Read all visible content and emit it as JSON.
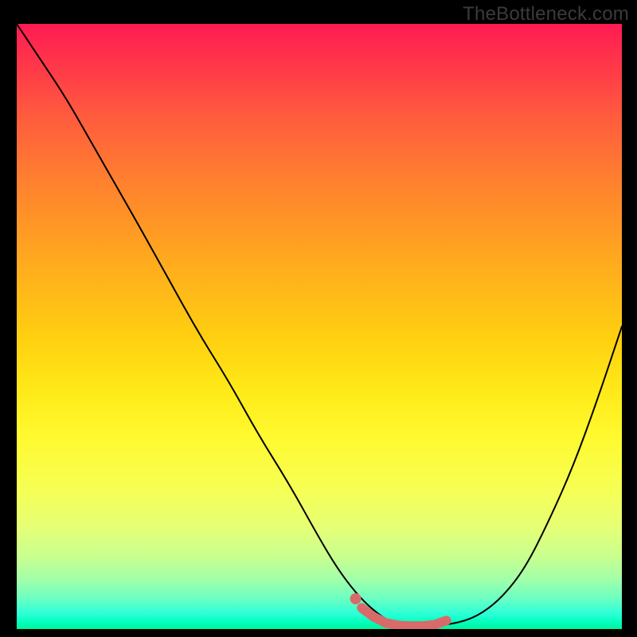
{
  "watermark": "TheBottleneck.com",
  "chart_data": {
    "type": "line",
    "title": "",
    "xlabel": "",
    "ylabel": "",
    "xlim": [
      0,
      100
    ],
    "ylim": [
      0,
      100
    ],
    "grid": false,
    "legend": false,
    "background_gradient": {
      "direction": "vertical",
      "stops": [
        {
          "pos": 0.0,
          "color": "#ff1b53"
        },
        {
          "pos": 0.15,
          "color": "#ff5a3e"
        },
        {
          "pos": 0.38,
          "color": "#ffa61f"
        },
        {
          "pos": 0.6,
          "color": "#ffe817"
        },
        {
          "pos": 0.77,
          "color": "#f6ff55"
        },
        {
          "pos": 0.92,
          "color": "#9fffaa"
        },
        {
          "pos": 1.0,
          "color": "#00f59a"
        }
      ]
    },
    "series": [
      {
        "name": "black-curve",
        "color": "#000000",
        "stroke_width": 2,
        "x": [
          0,
          4,
          8,
          12,
          16,
          20,
          25,
          30,
          35,
          40,
          45,
          50,
          53,
          56,
          59,
          62,
          65,
          68,
          72,
          76,
          80,
          84,
          88,
          92,
          96,
          100
        ],
        "y": [
          100,
          94,
          88,
          81,
          74,
          67,
          58,
          49,
          41,
          32,
          24,
          15,
          10,
          6,
          3,
          1,
          0.5,
          0.5,
          0.8,
          2,
          5,
          10,
          18,
          27,
          38,
          50
        ]
      }
    ],
    "highlight_segment": {
      "name": "pink-segment",
      "color": "#d96a6a",
      "stroke_width": 12,
      "x": [
        57,
        59,
        61,
        63,
        65,
        67,
        69,
        71
      ],
      "y": [
        3.5,
        2.0,
        1.0,
        0.6,
        0.5,
        0.5,
        0.7,
        1.4
      ]
    },
    "highlight_dot": {
      "name": "pink-dot",
      "color": "#d96a6a",
      "radius": 7,
      "x": 56,
      "y": 5
    }
  }
}
